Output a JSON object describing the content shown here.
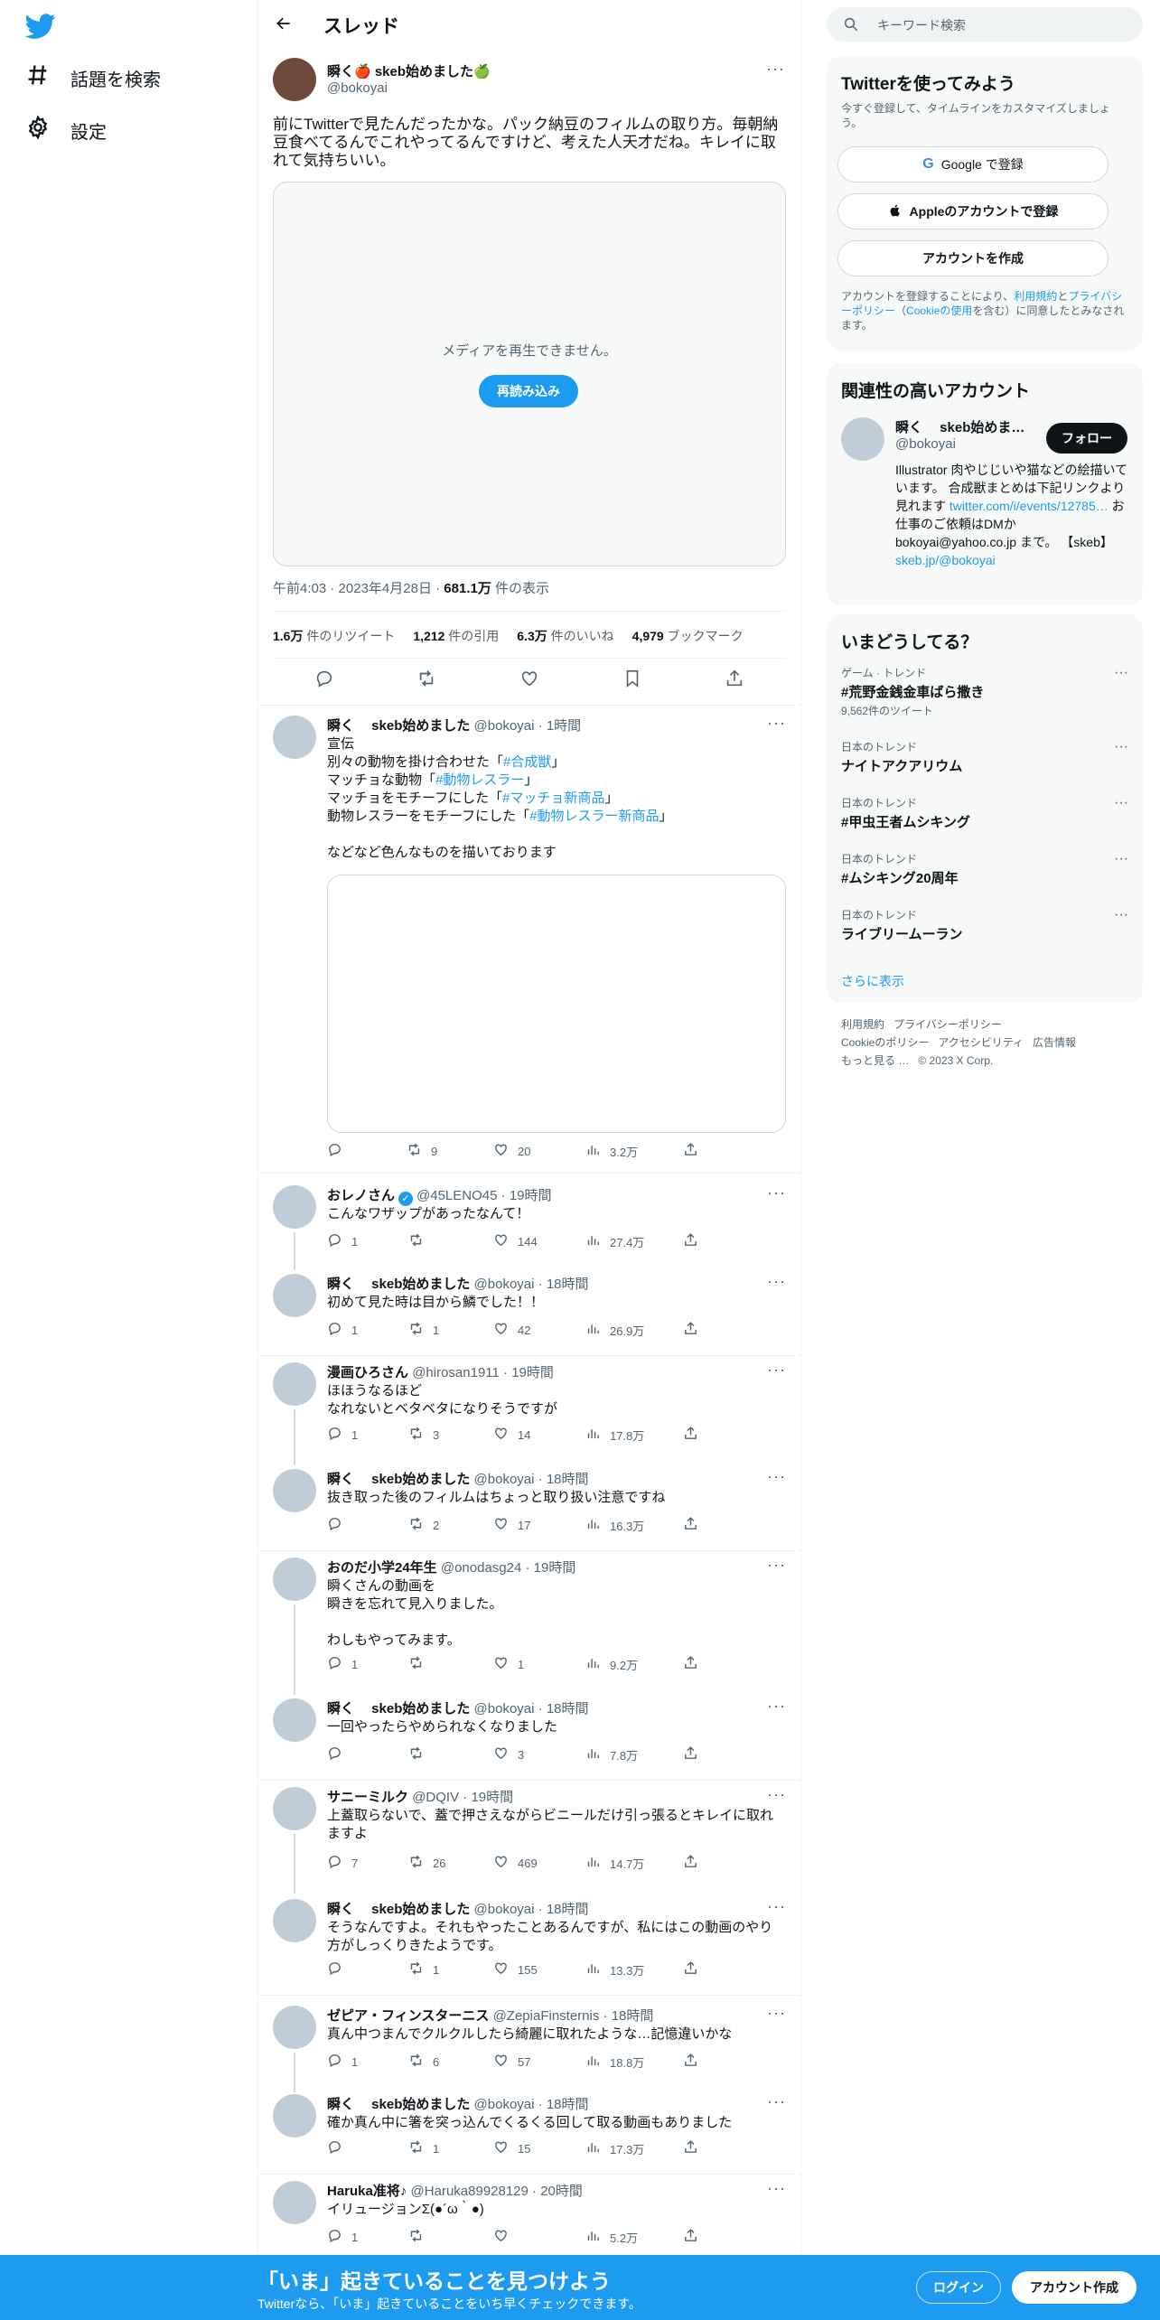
{
  "nav": {
    "explore_label": "話題を検索",
    "settings_label": "設定"
  },
  "header": {
    "title": "スレッド"
  },
  "tweet": {
    "author_name": "瞬く🍎 skeb始めました🍏",
    "author_handle": "@bokoyai",
    "text": "前にTwitterで見たんだったかな。パック納豆のフィルムの取り方。毎朝納豆食べてるんでこれやってるんですけど、考えた人天才だね。キレイに取れて気持ちいい。",
    "media_message": "メディアを再生できません。",
    "reload_label": "再読み込み",
    "time": "午前4:03",
    "date": "2023年4月28日",
    "views_value": "681.1万",
    "views_label": "件の表示",
    "retweets_value": "1.6万",
    "retweets_label": "件のリツイート",
    "quotes_value": "1,212",
    "quotes_label": "件の引用",
    "likes_value": "6.3万",
    "likes_label": "件のいいね",
    "bookmarks_value": "4,979",
    "bookmarks_label": "ブックマーク"
  },
  "self_reply": {
    "name": "瞬く　 skeb始めました",
    "handle": "@bokoyai",
    "time": "1時間",
    "line1": "宣伝",
    "line2a": "別々の動物を掛け合わせた「",
    "tag1": "#合成獣",
    "line2b": "」",
    "line3a": "マッチョな動物「",
    "tag2": "#動物レスラー",
    "line3b": "」",
    "line4a": "マッチョをモチーフにした「",
    "tag3": "#マッチョ新商品",
    "line4b": "」",
    "line5a": "動物レスラーをモチーフにした「",
    "tag4": "#動物レスラー新商品",
    "line5b": "」",
    "line6": "などなど色んなものを描いております",
    "retweets": "9",
    "likes": "20",
    "views": "3.2万"
  },
  "replies": [
    {
      "name": "おレノさん",
      "verified": true,
      "handle": "@45LENO45",
      "time": "19時間",
      "text": "こんなワザップがあったなんて！",
      "replies": "1",
      "retweets": "",
      "likes": "144",
      "views": "27.4万"
    },
    {
      "name": "瞬く　 skeb始めました",
      "handle": "@bokoyai",
      "time": "18時間",
      "text": "初めて見た時は目から鱗でした！！",
      "replies": "1",
      "retweets": "1",
      "likes": "42",
      "views": "26.9万"
    },
    {
      "name": "漫画ひろさん",
      "handle": "@hirosan1911",
      "time": "19時間",
      "text": "ほほうなるほど\nなれないとベタベタになりそうですが",
      "replies": "1",
      "retweets": "3",
      "likes": "14",
      "views": "17.8万"
    },
    {
      "name": "瞬く　 skeb始めました",
      "handle": "@bokoyai",
      "time": "18時間",
      "text": "抜き取った後のフィルムはちょっと取り扱い注意ですね",
      "replies": "",
      "retweets": "2",
      "likes": "17",
      "views": "16.3万"
    },
    {
      "name": "おのだ小学24年生",
      "handle": "@onodasg24",
      "time": "19時間",
      "text": "瞬くさんの動画を\n瞬きを忘れて見入りました。\n\nわしもやってみます。",
      "replies": "1",
      "retweets": "",
      "likes": "1",
      "views": "9.2万"
    },
    {
      "name": "瞬く　 skeb始めました",
      "handle": "@bokoyai",
      "time": "18時間",
      "text": "一回やったらやめられなくなりました",
      "replies": "",
      "retweets": "",
      "likes": "3",
      "views": "7.8万"
    },
    {
      "name": "サニーミルク",
      "handle": "@DQIV",
      "time": "19時間",
      "text": "上蓋取らないで、蓋で押さえながらビニールだけ引っ張るとキレイに取れますよ",
      "replies": "7",
      "retweets": "26",
      "likes": "469",
      "views": "14.7万"
    },
    {
      "name": "瞬く　 skeb始めました",
      "handle": "@bokoyai",
      "time": "18時間",
      "text": "そうなんですよ。それもやったことあるんですが、私にはこの動画のやり方がしっくりきたようです。",
      "replies": "",
      "retweets": "1",
      "likes": "155",
      "views": "13.3万"
    },
    {
      "name": "ゼピア・フィンスターニス",
      "handle": "@ZepiaFinsternis",
      "time": "18時間",
      "text": "真ん中つまんでクルクルしたら綺麗に取れたような…記憶違いかな",
      "replies": "1",
      "retweets": "6",
      "likes": "57",
      "views": "18.8万"
    },
    {
      "name": "瞬く　 skeb始めました",
      "handle": "@bokoyai",
      "time": "18時間",
      "text": "確か真ん中に箸を突っ込んでくるくる回して取る動画もありました",
      "replies": "",
      "retweets": "1",
      "likes": "15",
      "views": "17.3万"
    },
    {
      "name": "Haruka准将♪",
      "handle": "@Haruka89928129",
      "time": "20時間",
      "text": "イリュージョンΣ(●´ω｀●)",
      "replies": "1",
      "retweets": "",
      "likes": "",
      "views": "5.2万"
    }
  ],
  "sidebar": {
    "search_placeholder": "キーワード検索",
    "signup": {
      "title": "Twitterを使ってみよう",
      "subtitle": "今すぐ登録して、タイムラインをカスタマイズしましょう。",
      "google_label": "Google で登録",
      "apple_label": "Appleのアカウントで登録",
      "create_label": "アカウントを作成",
      "legal_a": "アカウントを登録することにより、",
      "legal_terms": "利用規約",
      "legal_b": "と",
      "legal_privacy": "プライバシーポリシー",
      "legal_c": "（",
      "legal_cookie": "Cookieの使用",
      "legal_d": "を含む）に同意したとみなされます。"
    },
    "relevant": {
      "title": "関連性の高いアカウント",
      "name": "瞬く　 skeb始めま…",
      "handle": "@bokoyai",
      "follow_label": "フォロー",
      "bio_a": "Illustrator 肉やじじいや猫などの絵描いています。 合成獣まとめは下記リンクより見れます",
      "bio_link1": "twitter.com/i/events/12785…",
      "bio_b": "お仕事のご依頼はDMか bokoyai@yahoo.co.jp まで。 【skeb】",
      "bio_link2": "skeb.jp/@bokoyai"
    },
    "trends": {
      "title": "いまどうしてる？",
      "items": [
        {
          "category": "ゲーム · トレンド",
          "name": "#荒野金銭金車ばら撒き",
          "count": "9,562件のツイート"
        },
        {
          "category": "日本のトレンド",
          "name": "ナイトアクアリウム",
          "count": ""
        },
        {
          "category": "日本のトレンド",
          "name": "#甲虫王者ムシキング",
          "count": ""
        },
        {
          "category": "日本のトレンド",
          "name": "#ムシキング20周年",
          "count": ""
        },
        {
          "category": "日本のトレンド",
          "name": "ライブリームーラン",
          "count": ""
        }
      ],
      "show_more": "さらに表示"
    },
    "footer": {
      "terms": "利用規約",
      "privacy": "プライバシーポリシー",
      "cookie": "Cookieのポリシー",
      "accessibility": "アクセシビリティ",
      "ads": "広告情報",
      "more": "もっと見る …",
      "copyright": "© 2023 X Corp."
    }
  },
  "bottom_bar": {
    "headline": "「いま」起きていることを見つけよう",
    "subline": "Twitterなら、「いま」起きていることをいち早くチェックできます。",
    "login_label": "ログイン",
    "signup_label": "アカウント作成"
  },
  "colors": {
    "accent": "#1d9bf0",
    "text": "#0f1419",
    "muted": "#536471"
  }
}
